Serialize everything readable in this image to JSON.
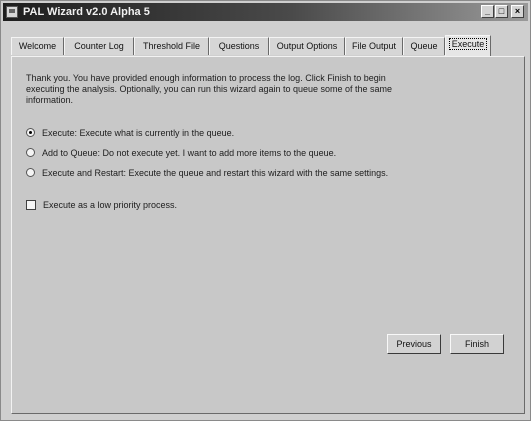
{
  "window": {
    "title": "PAL Wizard v2.0 Alpha 5",
    "minimize_glyph": "_",
    "maximize_glyph": "□",
    "close_glyph": "×"
  },
  "tabs": [
    {
      "label": "Welcome",
      "active": false
    },
    {
      "label": "Counter Log",
      "active": false
    },
    {
      "label": "Threshold File",
      "active": false
    },
    {
      "label": "Questions",
      "active": false
    },
    {
      "label": "Output Options",
      "active": false
    },
    {
      "label": "File Output",
      "active": false
    },
    {
      "label": "Queue",
      "active": false
    },
    {
      "label": "Execute",
      "active": true
    }
  ],
  "intro": "Thank you. You have provided enough information to process the log. Click Finish to begin executing the analysis. Optionally, you can run this wizard again to queue some of the same information.",
  "options": [
    {
      "label": "Execute: Execute what is currently in the queue.",
      "checked": true
    },
    {
      "label": "Add to Queue: Do not execute yet. I want to add more items to the queue.",
      "checked": false
    },
    {
      "label": "Execute and Restart: Execute the queue and restart this wizard with the same settings.",
      "checked": false
    }
  ],
  "low_priority": {
    "label": "Execute as a low priority process.",
    "checked": false
  },
  "buttons": {
    "previous": "Previous",
    "finish": "Finish"
  }
}
